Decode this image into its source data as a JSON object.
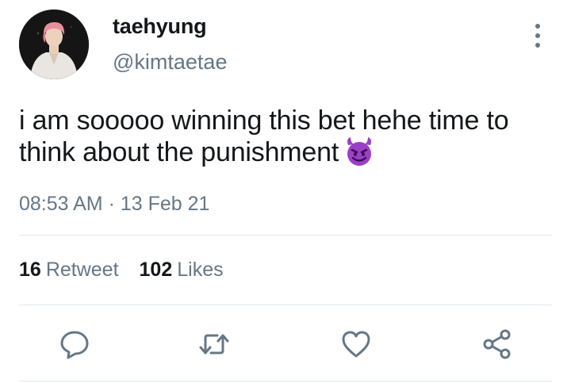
{
  "author": {
    "display_name": "taehyung",
    "handle": "@kimtaetae"
  },
  "tweet": {
    "text": "i am sooooo winning this bet hehe time to think about the punishment",
    "emoji": "smiling-face-with-horns"
  },
  "meta": {
    "time": "08:53 AM",
    "separator": "·",
    "date": "13 Feb 21"
  },
  "stats": {
    "retweets": {
      "count": "16",
      "label": "Retweet"
    },
    "likes": {
      "count": "102",
      "label": "Likes"
    }
  },
  "actions": [
    "reply-icon",
    "retweet-icon",
    "like-icon",
    "share-icon"
  ],
  "colors": {
    "text": "#14171a",
    "secondary": "#657786",
    "divider": "#e1e8ed",
    "emoji": "#9b3fc8"
  }
}
